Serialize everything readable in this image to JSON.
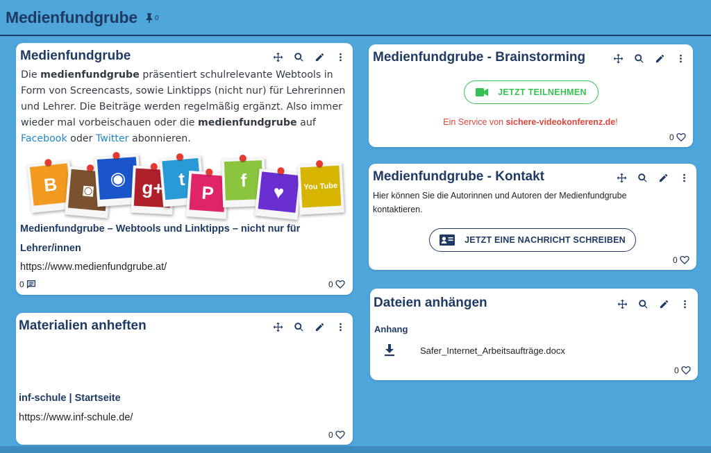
{
  "board": {
    "title": "Medienfundgrube",
    "pin_count": "0"
  },
  "card1": {
    "title": "Medienfundgrube",
    "desc_1": "Die ",
    "desc_bold1": "medienfundgrube",
    "desc_2": " präsentiert schulrelevante Webtools in Form von Screencasts, sowie Linktipps (nicht nur) für Lehrerinnen und Lehrer. Die Beiträge werden regelmäßig ergänzt. Also immer wieder mal vorbeischauen oder die ",
    "desc_bold2": "medienfundgrube",
    "desc_3": " auf ",
    "link_facebook": "Facebook",
    "desc_4": " oder ",
    "link_twitter": "Twitter",
    "desc_5": " abonnieren.",
    "link_title": "Medienfundgrube – Webtools und Linktipps – nicht nur für Lehrer/innen",
    "link_url": "https://www.medienfundgrube.at/",
    "comment_count": "0",
    "like_count": "0",
    "collage": [
      {
        "icon": "blogger-icon",
        "glyph": "B",
        "color": "#f29a1f"
      },
      {
        "icon": "instagram-icon",
        "glyph": "◙",
        "color": "#7a5230"
      },
      {
        "icon": "rss-icon",
        "glyph": "◉",
        "color": "#1a56c9"
      },
      {
        "icon": "googleplus-icon",
        "glyph": "g+",
        "color": "#b0202a"
      },
      {
        "icon": "tumblr-icon",
        "glyph": "t",
        "color": "#2a9ad6"
      },
      {
        "icon": "pinterest-icon",
        "glyph": "P",
        "color": "#e0246a"
      },
      {
        "icon": "facebook-icon",
        "glyph": "f",
        "color": "#8bc53f"
      },
      {
        "icon": "twitter-icon",
        "glyph": "♥",
        "color": "#6a2fd0"
      },
      {
        "icon": "youtube-icon",
        "glyph": "You Tube",
        "color": "#d6b400"
      }
    ]
  },
  "card2": {
    "title": "Materialien anheften",
    "link_title": "inf-schule | Startseite",
    "link_url": "https://www.inf-schule.de/",
    "like_count": "0"
  },
  "card3": {
    "title": "Medienfundgrube - Brainstorming",
    "button_label": "JETZT TEILNEHMEN",
    "service_1": "Ein Service von ",
    "service_bold": "sichere-videokonferenz.de",
    "service_2": "!",
    "like_count": "0"
  },
  "card4": {
    "title": "Medienfundgrube - Kontakt",
    "text": "Hier können Sie die Autorinnen und Autoren der Medienfundgrube kontaktieren.",
    "button_label": "JETZT EINE NACHRICHT SCHREIBEN",
    "like_count": "0"
  },
  "card5": {
    "title": "Dateien anhängen",
    "section_label": "Anhang",
    "file_name": "Safer_Internet_Arbeitsaufträge.docx",
    "like_count": "0"
  },
  "colors": {
    "background": "#4ea6db",
    "accent": "#1f3a63",
    "green": "#36c253",
    "red": "#e2453b",
    "link": "#1e88c7"
  }
}
